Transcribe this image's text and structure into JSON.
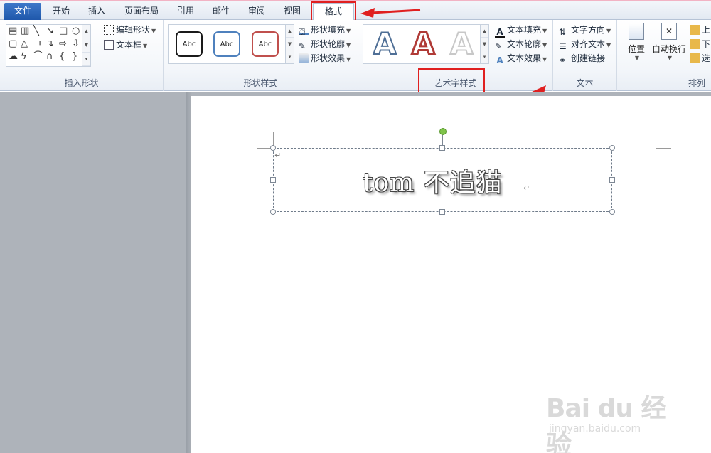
{
  "tabs": [
    {
      "label": "文件",
      "name": "tab-file"
    },
    {
      "label": "开始",
      "name": "tab-home"
    },
    {
      "label": "插入",
      "name": "tab-insert"
    },
    {
      "label": "页面布局",
      "name": "tab-page-layout"
    },
    {
      "label": "引用",
      "name": "tab-references"
    },
    {
      "label": "邮件",
      "name": "tab-mailings"
    },
    {
      "label": "审阅",
      "name": "tab-review"
    },
    {
      "label": "视图",
      "name": "tab-view"
    },
    {
      "label": "格式",
      "name": "tab-format"
    }
  ],
  "active_tab": "格式",
  "groups": {
    "insert_shapes": {
      "label": "插入形状",
      "edit_shape": "编辑形状",
      "text_box": "文本框"
    },
    "shape_styles": {
      "label": "形状样式",
      "gallery": [
        {
          "text": "Abc",
          "color": "#1a1a1a"
        },
        {
          "text": "Abc",
          "color": "#4f81bd"
        },
        {
          "text": "Abc",
          "color": "#c0504d"
        }
      ],
      "shape_fill": "形状填充",
      "shape_outline": "形状轮廓",
      "shape_effects": "形状效果"
    },
    "wordart_styles": {
      "label": "艺术字样式",
      "gallery": [
        {
          "text": "A",
          "outline": "#4f6f96"
        },
        {
          "text": "A",
          "outline": "#b03a36"
        },
        {
          "text": "A",
          "outline": "#c8c8c8"
        }
      ],
      "text_fill": "文本填充",
      "text_outline": "文本轮廓",
      "text_effects": "文本效果"
    },
    "text": {
      "label": "文本",
      "text_direction": "文字方向",
      "align_text": "对齐文本",
      "create_link": "创建链接"
    },
    "arrange": {
      "label": "排列",
      "position": "位置",
      "wrap_text": "自动换行",
      "bring_forward": "上",
      "send_backward": "下",
      "selection_pane": "选"
    }
  },
  "document": {
    "wordart_text": "tom 不追猫"
  },
  "watermark": {
    "logo": "Bai du 经验",
    "url": "jingyan.baidu.com"
  },
  "colors": {
    "annotation_red": "#e02020",
    "file_tab_blue": "#2a62b5",
    "rotate_handle_green": "#7fc34a"
  }
}
